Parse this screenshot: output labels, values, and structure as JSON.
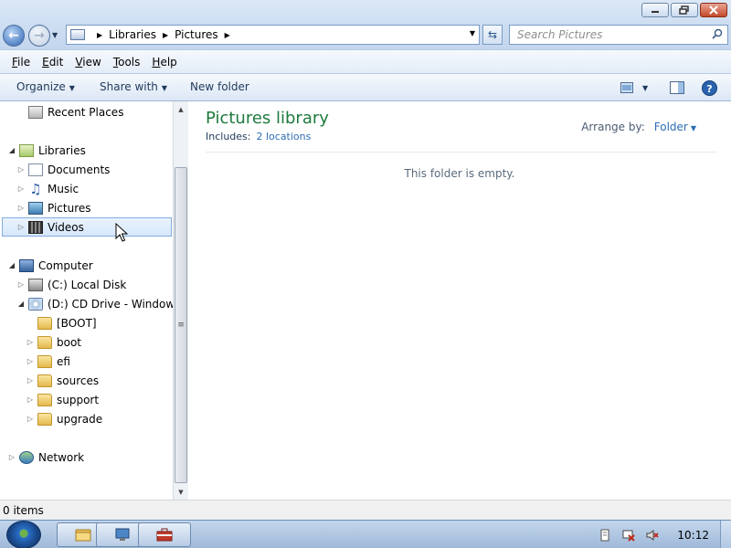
{
  "window": {
    "controls": {
      "minimize_icon": "minimize-icon",
      "maximize_icon": "restore-icon",
      "close_icon": "close-icon"
    }
  },
  "address_bar": {
    "crumbs": [
      "Libraries",
      "Pictures"
    ],
    "search_placeholder": "Search Pictures"
  },
  "menu": {
    "items": [
      "File",
      "Edit",
      "View",
      "Tools",
      "Help"
    ]
  },
  "toolbar": {
    "organize_label": "Organize",
    "share_label": "Share with",
    "new_folder_label": "New folder"
  },
  "nav_tree": {
    "recent_places": "Recent Places",
    "libraries": "Libraries",
    "documents": "Documents",
    "music": "Music",
    "pictures": "Pictures",
    "videos": "Videos",
    "computer": "Computer",
    "local_disk": "(C:) Local Disk",
    "cd_drive": "(D:) CD Drive - Windows U",
    "boot_upper": "[BOOT]",
    "boot": "boot",
    "efi": "efi",
    "sources": "sources",
    "support": "support",
    "upgrade": "upgrade",
    "network": "Network"
  },
  "content": {
    "title": "Pictures library",
    "includes_label": "Includes:",
    "includes_link": "2 locations",
    "arrange_label": "Arrange by:",
    "arrange_value": "Folder",
    "empty_message": "This folder is empty."
  },
  "status": {
    "item_count": "0 items"
  },
  "taskbar": {
    "clock": "10:12"
  },
  "colors": {
    "library_title": "#1e7a3e",
    "link": "#2d6db5",
    "selection_border": "#84acdd"
  }
}
